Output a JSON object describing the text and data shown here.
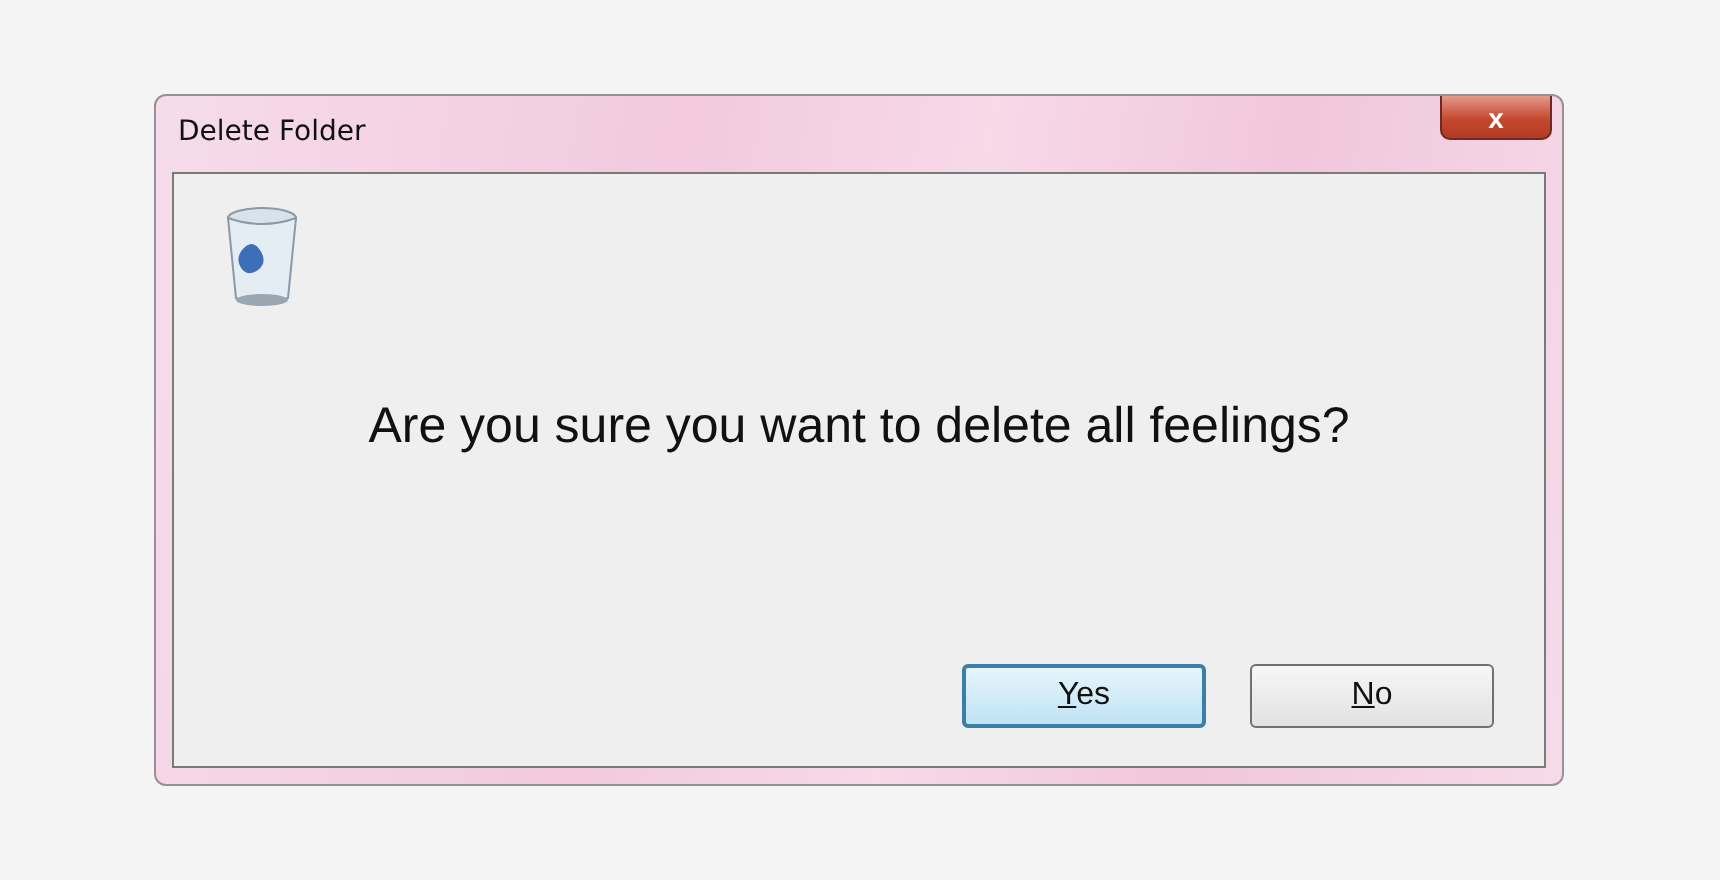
{
  "window": {
    "title": "Delete Folder",
    "close_label": "x"
  },
  "message": "Are you sure you want to delete all feelings?",
  "buttons": [
    {
      "label": "Yes",
      "default": true
    },
    {
      "label": "No",
      "default": false
    }
  ]
}
